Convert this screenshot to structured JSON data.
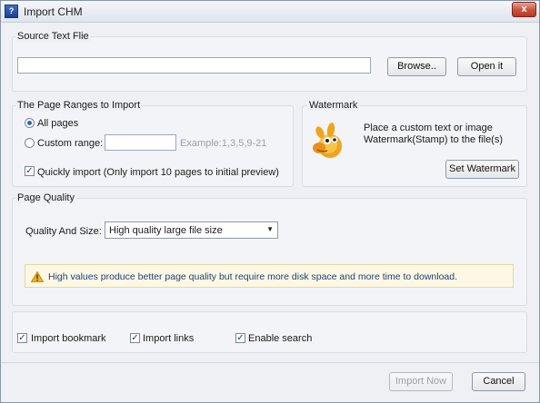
{
  "window": {
    "title": "Import CHM",
    "close_label": "x"
  },
  "source": {
    "label": "Source Text Flie",
    "path_value": "",
    "browse_label": "Browse..",
    "open_label": "Open it"
  },
  "ranges": {
    "label": "The Page Ranges to Import",
    "all_pages_label": "All pages",
    "custom_range_label": "Custom range:",
    "custom_range_value": "",
    "example_text": "Example:1,3,5,9-21",
    "quick_import_label": "Quickly import (Only import 10 pages to  initial  preview)",
    "all_pages_selected": true,
    "quick_import_checked": true
  },
  "watermark": {
    "label": "Watermark",
    "description_line1": "Place a custom text or image",
    "description_line2": "Watermark(Stamp) to the file(s)",
    "button_label": "Set Watermark",
    "icon": "gimp-mascot-icon"
  },
  "quality": {
    "label": "Page Quality",
    "size_label": "Quality And Size:",
    "selected_option": "High quality large file size",
    "warning": "High values produce better page quality but require more disk space and more time to download."
  },
  "options": {
    "import_bookmark_label": "Import bookmark",
    "import_links_label": "Import links",
    "enable_search_label": "Enable search",
    "import_bookmark_checked": true,
    "import_links_checked": true,
    "enable_search_checked": true
  },
  "footer": {
    "import_now_label": "Import Now",
    "cancel_label": "Cancel"
  }
}
